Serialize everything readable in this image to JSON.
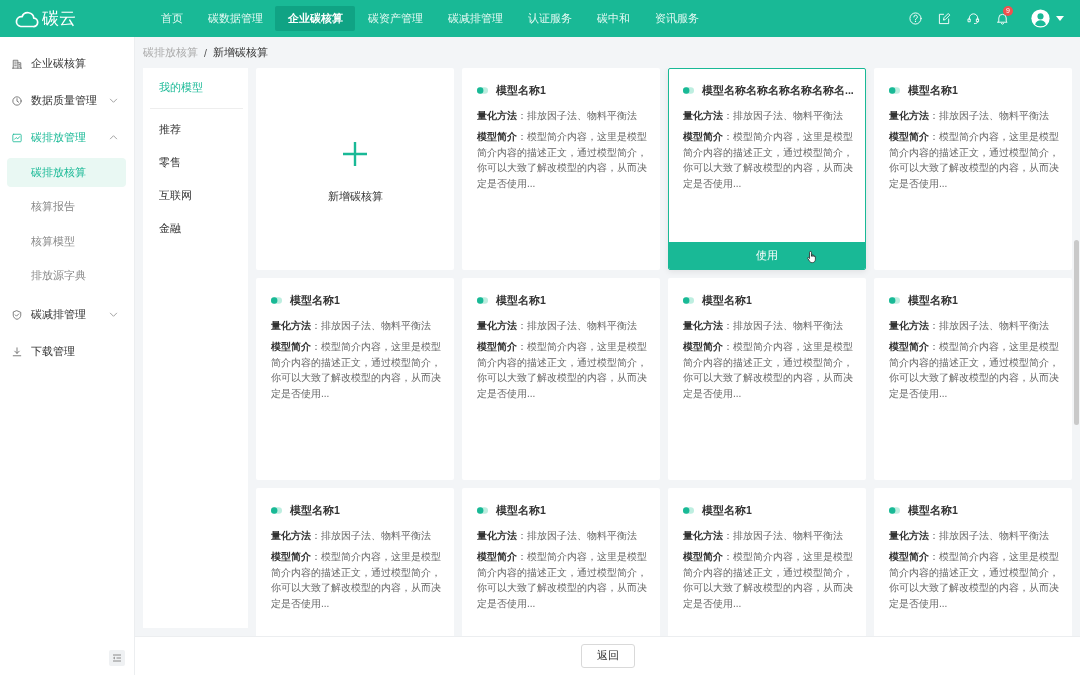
{
  "header": {
    "logo": "碳云",
    "nav": [
      {
        "label": "首页",
        "selected": false
      },
      {
        "label": "碳数据管理",
        "selected": false
      },
      {
        "label": "企业碳核算",
        "selected": true
      },
      {
        "label": "碳资产管理",
        "selected": false
      },
      {
        "label": "碳减排管理",
        "selected": false
      },
      {
        "label": "认证服务",
        "selected": false
      },
      {
        "label": "碳中和",
        "selected": false
      },
      {
        "label": "资讯服务",
        "selected": false
      }
    ],
    "notification_badge": "9"
  },
  "sidebar": {
    "items": [
      {
        "kind": "link",
        "label": "企业碳核算",
        "active": false
      },
      {
        "kind": "group",
        "label": "数据质量管理",
        "active": false,
        "expanded": false
      },
      {
        "kind": "group",
        "label": "碳排放管理",
        "active": true,
        "expanded": true,
        "children": [
          {
            "label": "碳排放核算",
            "selected": true
          },
          {
            "label": "核算报告",
            "selected": false
          },
          {
            "label": "核算模型",
            "selected": false
          },
          {
            "label": "排放源字典",
            "selected": false
          }
        ]
      },
      {
        "kind": "group",
        "label": "碳减排管理",
        "active": false,
        "expanded": false
      },
      {
        "kind": "link",
        "label": "下载管理",
        "active": false
      }
    ]
  },
  "breadcrumb": {
    "items": [
      "碳排放核算",
      "新增碳核算"
    ],
    "separator": "/"
  },
  "categories": [
    {
      "label": "我的模型",
      "selected": true
    },
    {
      "label": "推荐",
      "selected": false
    },
    {
      "label": "零售",
      "selected": false
    },
    {
      "label": "互联网",
      "selected": false
    },
    {
      "label": "金融",
      "selected": false
    }
  ],
  "cards": [
    {
      "kind": "add",
      "label": "新增碳核算",
      "hovered": false
    },
    {
      "kind": "model",
      "title": "模型名称1",
      "method": "**量化方法**：排放因子法、物料平衡法",
      "description": "**模型简介**：模型简介内容，这里是模型简介内容的描述正文，通过模型简介，你可以大致了解改模型的内容，从而决定是否使用...",
      "hovered": false
    },
    {
      "kind": "model",
      "title": "模型名称名称名称名称名称名...",
      "method": "**量化方法**：排放因子法、物料平衡法",
      "description": "**模型简介**：模型简介内容，这里是模型简介内容的描述正文，通过模型简介，你可以大致了解改模型的内容，从而决定是否使用...",
      "hovered": true,
      "button": "使用"
    },
    {
      "kind": "model",
      "title": "模型名称1",
      "method": "**量化方法**：排放因子法、物料平衡法",
      "description": "**模型简介**：模型简介内容，这里是模型简介内容的描述正文，通过模型简介，你可以大致了解改模型的内容，从而决定是否使用...",
      "hovered": false
    },
    {
      "kind": "model",
      "title": "模型名称1",
      "method": "**量化方法**：排放因子法、物料平衡法",
      "description": "**模型简介**：模型简介内容，这里是模型简介内容的描述正文，通过模型简介，你可以大致了解改模型的内容，从而决定是否使用...",
      "hovered": false
    },
    {
      "kind": "model",
      "title": "模型名称1",
      "method": "**量化方法**：排放因子法、物料平衡法",
      "description": "**模型简介**：模型简介内容，这里是模型简介内容的描述正文，通过模型简介，你可以大致了解改模型的内容，从而决定是否使用...",
      "hovered": false
    },
    {
      "kind": "model",
      "title": "模型名称1",
      "method": "**量化方法**：排放因子法、物料平衡法",
      "description": "**模型简介**：模型简介内容，这里是模型简介内容的描述正文，通过模型简介，你可以大致了解改模型的内容，从而决定是否使用...",
      "hovered": false
    },
    {
      "kind": "model",
      "title": "模型名称1",
      "method": "**量化方法**：排放因子法、物料平衡法",
      "description": "**模型简介**：模型简介内容，这里是模型简介内容的描述正文，通过模型简介，你可以大致了解改模型的内容，从而决定是否使用...",
      "hovered": false
    },
    {
      "kind": "model",
      "title": "模型名称1",
      "method": "**量化方法**：排放因子法、物料平衡法",
      "description": "**模型简介**：模型简介内容，这里是模型简介内容的描述正文，通过模型简介，你可以大致了解改模型的内容，从而决定是否使用...",
      "hovered": false
    },
    {
      "kind": "model",
      "title": "模型名称1",
      "method": "**量化方法**：排放因子法、物料平衡法",
      "description": "**模型简介**：模型简介内容，这里是模型简介内容的描述正文，通过模型简介，你可以大致了解改模型的内容，从而决定是否使用...",
      "hovered": false
    },
    {
      "kind": "model",
      "title": "模型名称1",
      "method": "**量化方法**：排放因子法、物料平衡法",
      "description": "**模型简介**：模型简介内容，这里是模型简介内容的描述正文，通过模型简介，你可以大致了解改模型的内容，从而决定是否使用...",
      "hovered": false
    },
    {
      "kind": "model",
      "title": "模型名称1",
      "method": "**量化方法**：排放因子法、物料平衡法",
      "description": "**模型简介**：模型简介内容，这里是模型简介内容的描述正文，通过模型简介，你可以大致了解改模型的内容，从而决定是否使用...",
      "hovered": false
    }
  ],
  "footer": {
    "back_button": "返回"
  }
}
